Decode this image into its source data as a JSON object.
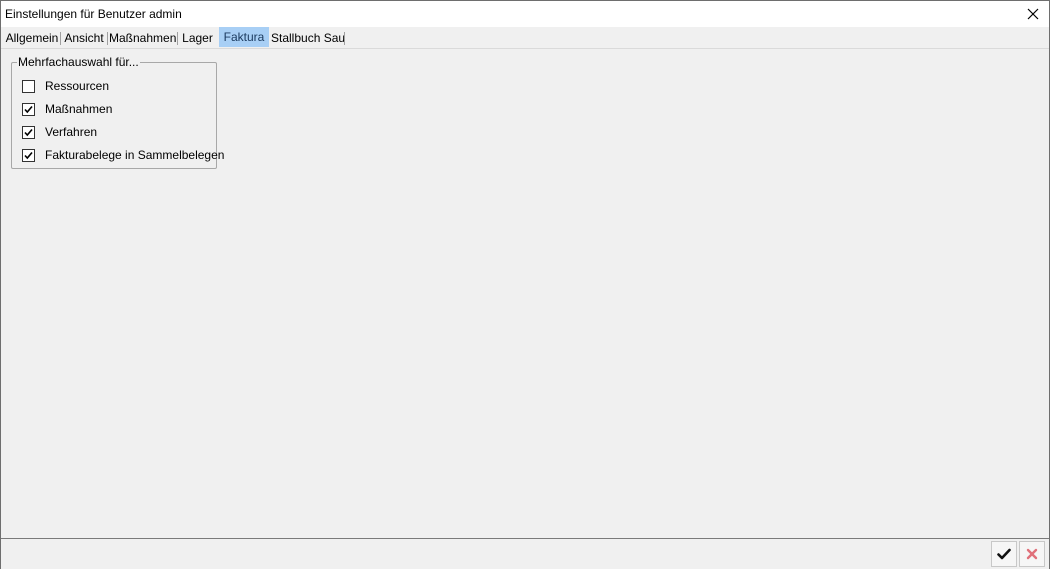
{
  "window": {
    "title": "Einstellungen für Benutzer admin"
  },
  "tabs": [
    {
      "label": "Allgemein",
      "active": false
    },
    {
      "label": "Ansicht",
      "active": false
    },
    {
      "label": "Maßnahmen",
      "active": false
    },
    {
      "label": "Lager",
      "active": false
    },
    {
      "label": "Faktura",
      "active": true
    },
    {
      "label": "Stallbuch Sau",
      "active": false
    }
  ],
  "group": {
    "legend": "Mehrfachauswahl für...",
    "options": [
      {
        "label": "Ressourcen",
        "checked": false
      },
      {
        "label": "Maßnahmen",
        "checked": true
      },
      {
        "label": "Verfahren",
        "checked": true
      },
      {
        "label": "Fakturabelege in Sammelbelegen",
        "checked": true
      }
    ]
  },
  "footer": {
    "ok_icon": "checkmark-icon",
    "cancel_icon": "cross-icon"
  },
  "colors": {
    "active_tab": "#a8cff5",
    "window_bg": "#f0f0f0",
    "cancel_red": "#e0707a"
  }
}
